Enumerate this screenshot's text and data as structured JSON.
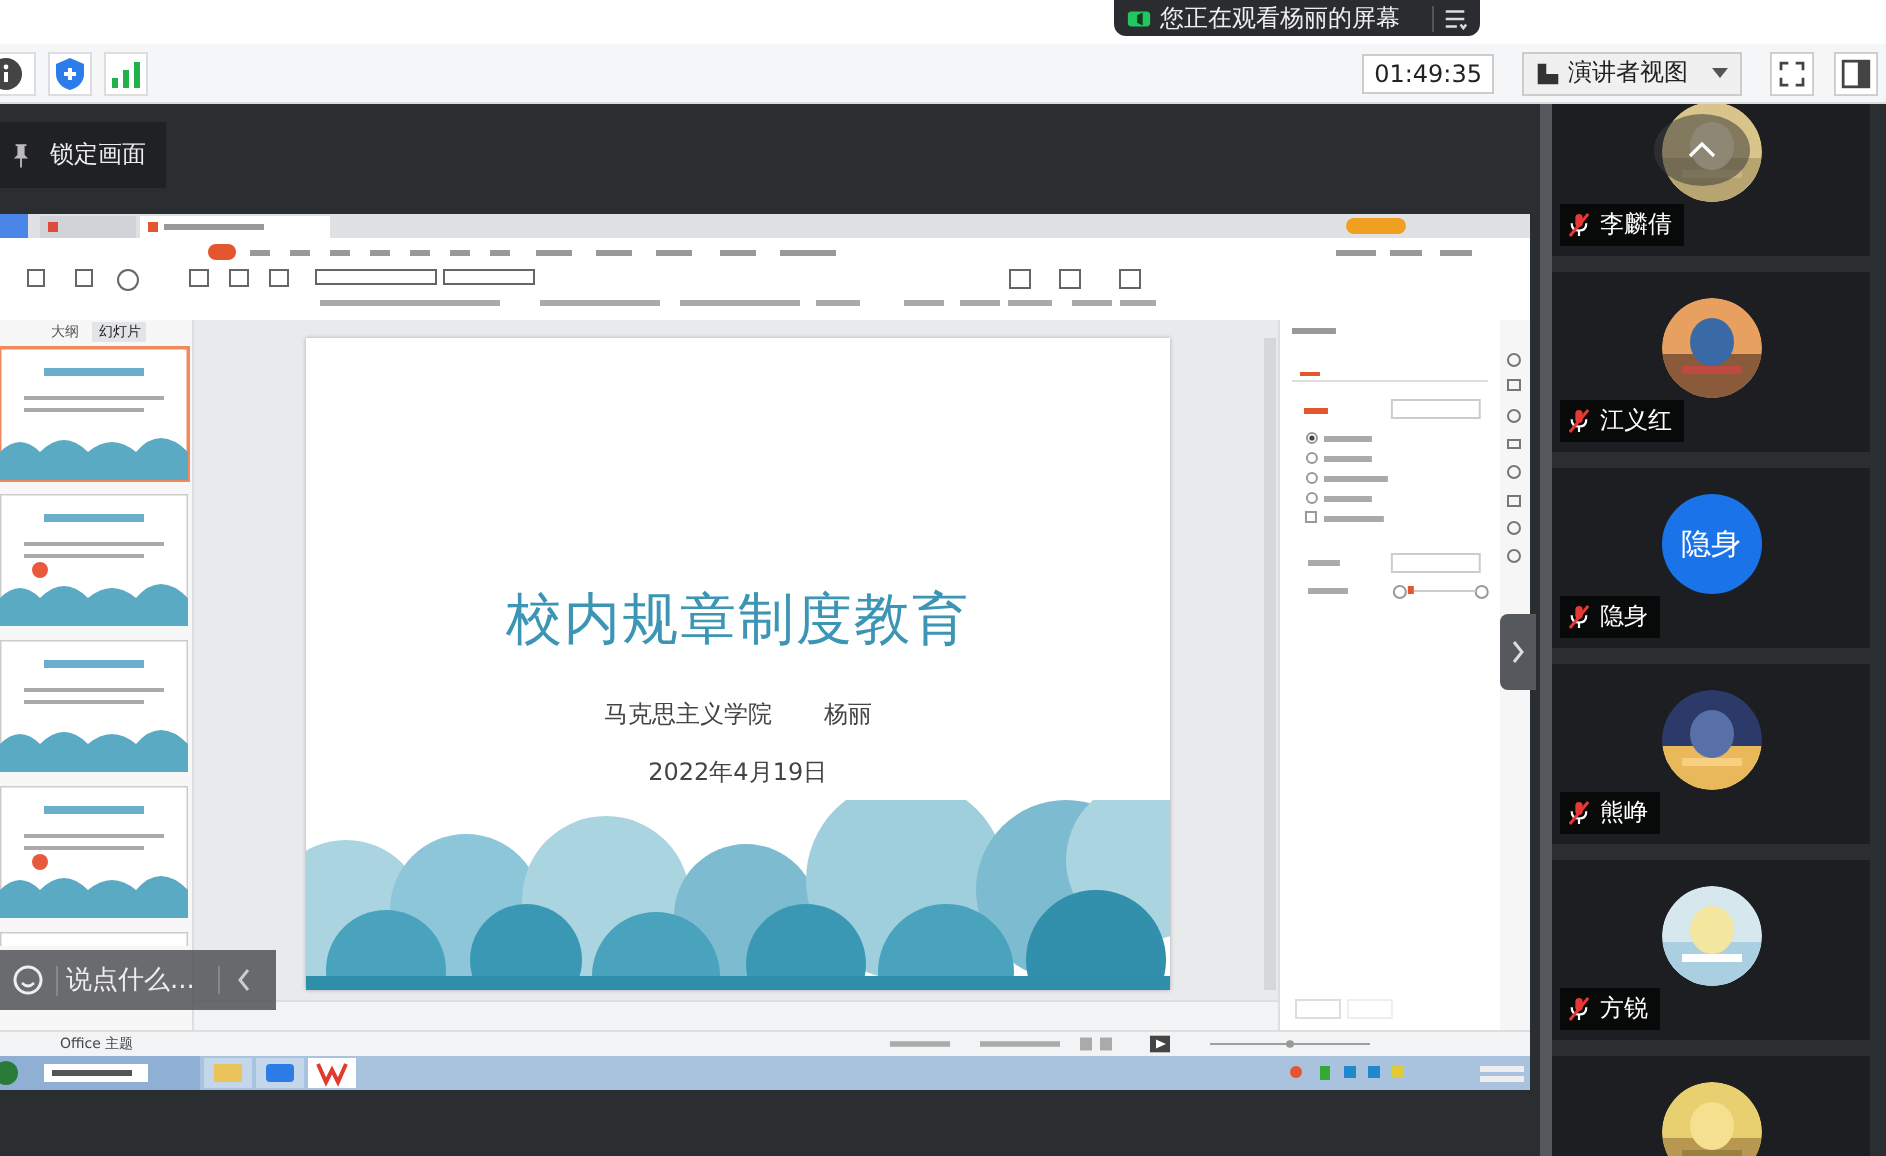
{
  "banner": {
    "text": "您正在观看杨丽的屏幕"
  },
  "toolbar": {
    "timer": "01:49:35",
    "view_button": "演讲者视图"
  },
  "lock_button": "锁定画面",
  "shared_screen": {
    "panel_tabs": [
      {
        "label": "大纲",
        "selected": false
      },
      {
        "label": "幻灯片",
        "selected": true
      }
    ],
    "thumbnails": [
      {
        "selected": true
      },
      {
        "selected": false
      },
      {
        "selected": false
      },
      {
        "selected": false
      },
      {
        "selected": false
      }
    ],
    "slide": {
      "title": "校内规章制度教育",
      "department": "马克思主义学院",
      "presenter": "杨丽",
      "date": "2022年4月19日"
    },
    "status_theme": "Office 主题"
  },
  "chat_input": {
    "placeholder": "说点什么..."
  },
  "participants": [
    {
      "name": "李麟倩",
      "muted": true,
      "avatar": {
        "kind": "picture"
      }
    },
    {
      "name": "江义红",
      "muted": true,
      "avatar": {
        "kind": "picture"
      }
    },
    {
      "name": "隐身",
      "muted": true,
      "avatar": {
        "kind": "text",
        "text": "隐身"
      }
    },
    {
      "name": "熊峥",
      "muted": true,
      "avatar": {
        "kind": "picture"
      }
    },
    {
      "name": "方锐",
      "muted": true,
      "avatar": {
        "kind": "picture"
      }
    },
    {
      "avatar": {
        "kind": "picture"
      }
    }
  ]
}
